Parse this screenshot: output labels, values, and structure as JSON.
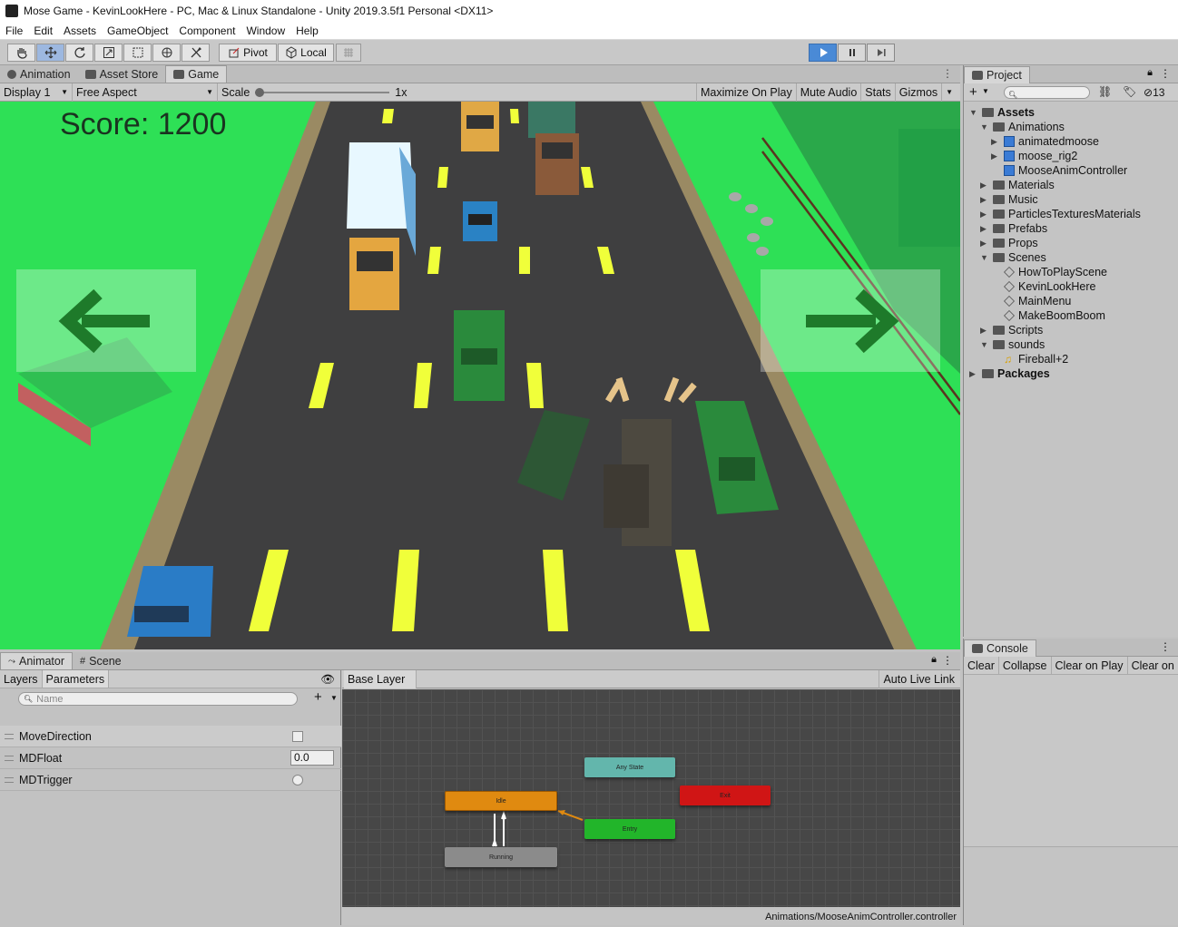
{
  "window": {
    "title": "Mose Game - KevinLookHere - PC, Mac & Linux Standalone - Unity 2019.3.5f1 Personal <DX11>"
  },
  "menu": [
    "File",
    "Edit",
    "Assets",
    "GameObject",
    "Component",
    "Window",
    "Help"
  ],
  "toolbar": {
    "pivot": "Pivot",
    "local": "Local"
  },
  "top_tabs": {
    "animation": "Animation",
    "asset_store": "Asset Store",
    "game": "Game"
  },
  "game_bar": {
    "display": "Display 1",
    "aspect": "Free Aspect",
    "scale_label": "Scale",
    "scale_value": "1x",
    "maximize": "Maximize On Play",
    "mute": "Mute Audio",
    "stats": "Stats",
    "gizmos": "Gizmos"
  },
  "game": {
    "score": "Score: 1200"
  },
  "project": {
    "title": "Project",
    "count": "13",
    "tree": [
      {
        "label": "Assets",
        "bold": true
      },
      {
        "label": "Animations"
      },
      {
        "label": "animatedmoose"
      },
      {
        "label": "moose_rig2"
      },
      {
        "label": "MooseAnimController"
      },
      {
        "label": "Materials"
      },
      {
        "label": "Music"
      },
      {
        "label": "ParticlesTexturesMaterials"
      },
      {
        "label": "Prefabs"
      },
      {
        "label": "Props"
      },
      {
        "label": "Scenes"
      },
      {
        "label": "HowToPlayScene"
      },
      {
        "label": "KevinLookHere"
      },
      {
        "label": "MainMenu"
      },
      {
        "label": "MakeBoomBoom"
      },
      {
        "label": "Scripts"
      },
      {
        "label": "sounds"
      },
      {
        "label": "Fireball+2"
      },
      {
        "label": "Packages",
        "bold": true
      }
    ]
  },
  "console": {
    "title": "Console",
    "clear": "Clear",
    "collapse": "Collapse",
    "clear_on_play": "Clear on Play",
    "clear_on": "Clear on"
  },
  "animator": {
    "tab_animator": "Animator",
    "tab_scene": "Scene",
    "layers": "Layers",
    "parameters": "Parameters",
    "search_placeholder": "Name",
    "base_layer": "Base Layer",
    "auto_live_link": "Auto Live Link",
    "params": [
      {
        "name": "MoveDirection",
        "type": "bool"
      },
      {
        "name": "MDFloat",
        "type": "float",
        "value": "0.0"
      },
      {
        "name": "MDTrigger",
        "type": "trigger"
      }
    ],
    "states": {
      "any_state": "Any State",
      "idle": "Idle",
      "exit": "Exit",
      "entry": "Entry",
      "running": "Running"
    },
    "path": "Animations/MooseAnimController.controller"
  },
  "colors": {
    "play_active": "#4a8ad6",
    "grass": "#2ee056",
    "road": "#3f3f40",
    "lane": "#f0ff3a",
    "idle_state": "#e08a10",
    "entry_state": "#22b52a",
    "exit_state": "#d01515",
    "any_state": "#63b6ac"
  }
}
